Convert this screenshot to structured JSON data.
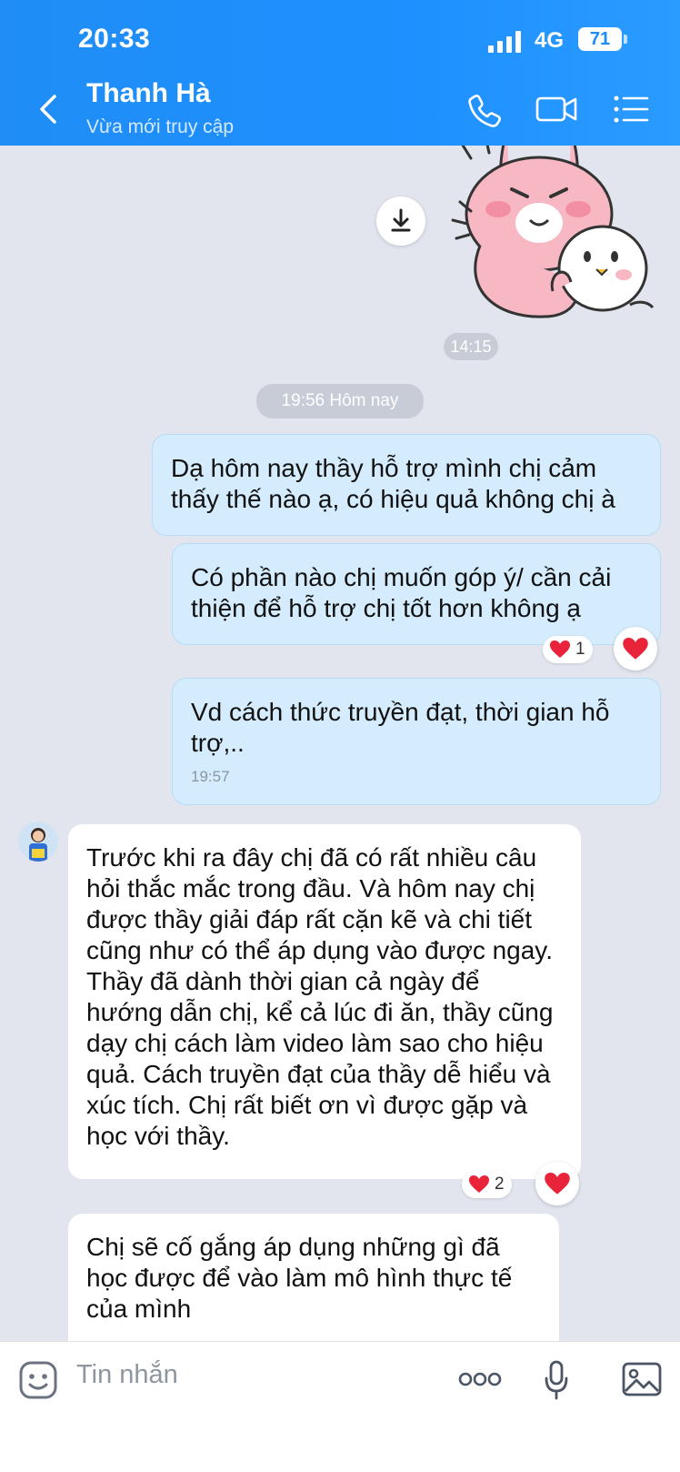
{
  "status_bar": {
    "time": "20:33",
    "network": "4G",
    "battery": "71"
  },
  "header": {
    "name": "Thanh Hà",
    "status": "Vừa mới truy cập"
  },
  "timestamps": {
    "t1": "14:15",
    "t2": "19:56 Hôm nay"
  },
  "messages": [
    {
      "text": "Dạ hôm nay thầy hỗ trợ mình chị cảm thấy thế nào ạ, có hiệu quả không chị à"
    },
    {
      "text": "Có phần nào chị muốn góp ý/ cần cải thiện để hỗ trợ chị tốt hơn không ạ",
      "reaction_count": "1"
    },
    {
      "text": "Vd cách thức truyền đạt, thời gian hỗ trợ,..",
      "time": "19:57"
    },
    {
      "text": "Trước khi ra đây chị đã có rất nhiều câu hỏi thắc mắc trong đầu. Và hôm nay chị được thầy giải đáp rất cặn kẽ và chi tiết cũng như có thể áp dụng vào được ngay. Thầy đã dành thời gian cả ngày để hướng dẫn chị, kể cả lúc đi ăn, thầy cũng dạy chị cách làm video làm sao cho hiệu quả. Cách truyền đạt của thầy dễ hiểu và xúc tích. Chị rất biết ơn vì được gặp và học với thầy.",
      "reaction_count": "2"
    },
    {
      "text": "Chị sẽ cố gắng áp dụng những gì đã học được để vào làm mô hình thực tế của mình"
    }
  ],
  "composer": {
    "placeholder": "Tin nhắn"
  },
  "colors": {
    "header": "#1e8cf5",
    "background": "#e2e5ee",
    "outgoing_bubble": "#d4ecfd",
    "heart": "#e8233a"
  },
  "icons": [
    "back-icon",
    "phone-icon",
    "video-icon",
    "menu-icon",
    "download-icon",
    "heart-icon",
    "sticker-icon",
    "more-icon",
    "mic-icon",
    "image-icon"
  ]
}
